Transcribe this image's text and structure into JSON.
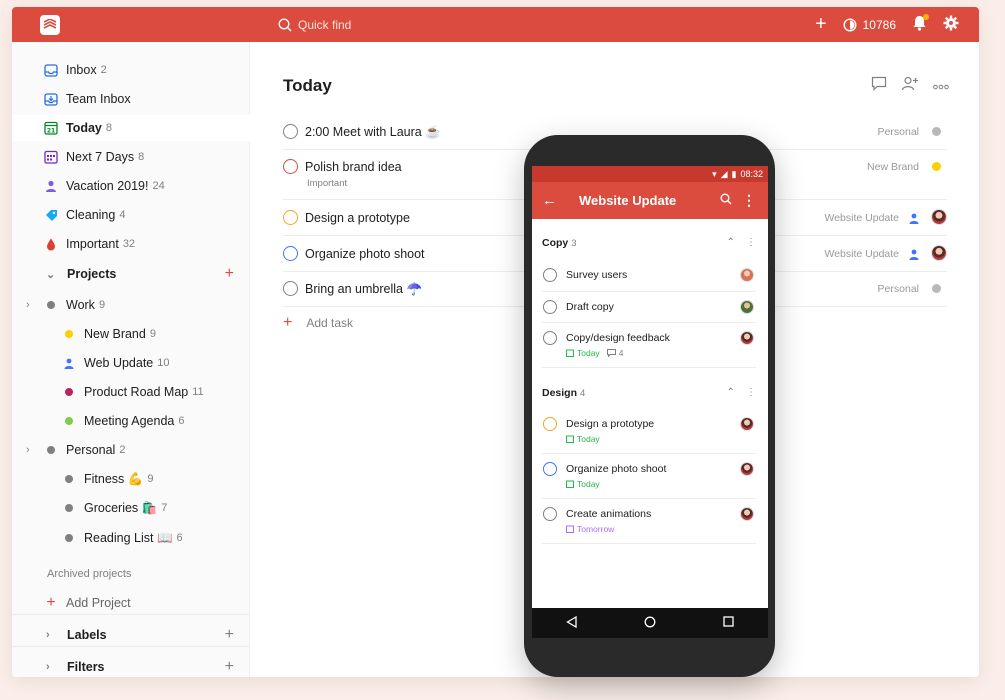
{
  "topbar": {
    "search_placeholder": "Quick find",
    "karma": "10786"
  },
  "sidebar": {
    "inbox": {
      "label": "Inbox",
      "count": "2"
    },
    "team_inbox": {
      "label": "Team Inbox"
    },
    "today": {
      "label": "Today",
      "count": "8"
    },
    "next7": {
      "label": "Next 7 Days",
      "count": "8"
    },
    "vacation": {
      "label": "Vacation 2019!",
      "count": "24"
    },
    "cleaning": {
      "label": "Cleaning",
      "count": "4"
    },
    "important": {
      "label": "Important",
      "count": "32"
    },
    "projects_label": "Projects",
    "work": {
      "label": "Work",
      "count": "9"
    },
    "new_brand": {
      "label": "New Brand",
      "count": "9"
    },
    "web_update": {
      "label": "Web Update",
      "count": "10"
    },
    "road_map": {
      "label": "Product Road Map",
      "count": "11"
    },
    "meeting": {
      "label": "Meeting Agenda",
      "count": "6"
    },
    "personal": {
      "label": "Personal",
      "count": "2"
    },
    "fitness": {
      "label": "Fitness 💪",
      "count": "9"
    },
    "groceries": {
      "label": "Groceries 🛍️",
      "count": "7"
    },
    "reading": {
      "label": "Reading List 📖",
      "count": "6"
    },
    "archived": "Archived projects",
    "add_project": "Add Project",
    "labels": "Labels",
    "filters": "Filters"
  },
  "main": {
    "title": "Today",
    "tasks": [
      {
        "text": "2:00 Meet with Laura ☕",
        "project": "Personal"
      },
      {
        "text": "Polish brand idea",
        "sub": "Important",
        "project": "New Brand"
      },
      {
        "text": "Design a prototype",
        "project": "Website Update"
      },
      {
        "text": "Organize photo shoot",
        "project": "Website Update"
      },
      {
        "text": "Bring an umbrella ☂️",
        "project": "Personal"
      }
    ],
    "add_task": "Add task"
  },
  "phone": {
    "time": "08:32",
    "title": "Website Update",
    "sections": [
      {
        "name": "Copy",
        "count": "3"
      },
      {
        "name": "Design",
        "count": "4"
      }
    ],
    "tasks": [
      {
        "text": "Survey users"
      },
      {
        "text": "Draft copy"
      },
      {
        "text": "Copy/design feedback",
        "date": "Today",
        "comments": "4"
      },
      {
        "text": "Design a prototype",
        "date": "Today"
      },
      {
        "text": "Organize photo shoot",
        "date": "Today"
      },
      {
        "text": "Create animations",
        "date": "Tomorrow"
      }
    ]
  },
  "colors": {
    "accent": "#db4c3f",
    "today_green": "#25b84c",
    "tomorrow_purple": "#a970ff"
  }
}
